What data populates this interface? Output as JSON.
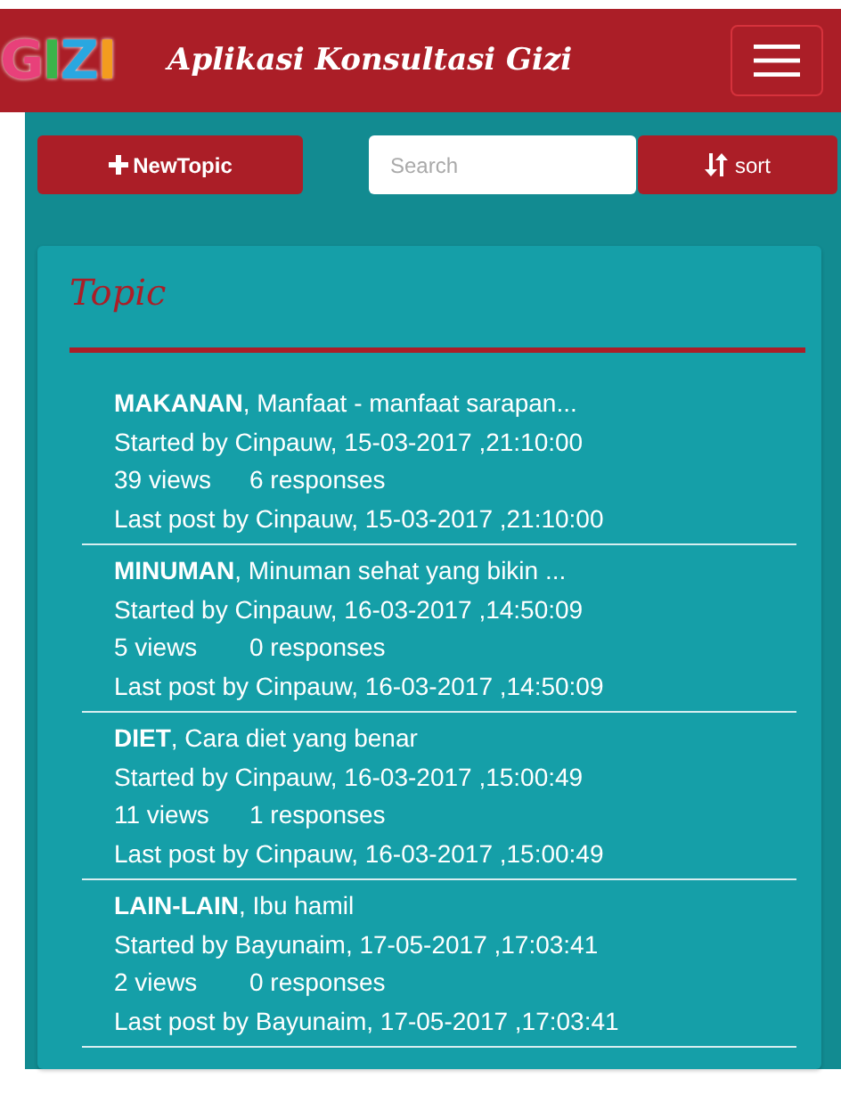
{
  "header": {
    "logo": "GIZI",
    "title": "Aplikasi Konsultasi Gizi"
  },
  "toolbar": {
    "new_topic": "NewTopic",
    "search": {
      "placeholder": "Search"
    },
    "sort": "sort"
  },
  "panel": {
    "title": "Topic",
    "topics": [
      {
        "title": "**MAKANAN**, Manfaat - manfaat sarapan...",
        "started": "Started by Cinpauw, 15-03-2017 ,21:10:00",
        "views": "39 views",
        "responses": "6 responses",
        "last_post": "Last post by Cinpauw, 15-03-2017 ,21:10:00"
      },
      {
        "title": "**MINUMAN**, Minuman sehat yang bikin ...",
        "started": "Started by Cinpauw, 16-03-2017 ,14:50:09",
        "views": "5 views",
        "responses": "0 responses",
        "last_post": "Last post by Cinpauw, 16-03-2017 ,14:50:09"
      },
      {
        "title": "**DIET**, Cara diet yang benar",
        "started": "Started by Cinpauw, 16-03-2017 ,15:00:49",
        "views": "11 views",
        "responses": "1 responses",
        "last_post": "Last post by Cinpauw, 16-03-2017 ,15:00:49"
      },
      {
        "title": "**LAIN-LAIN**, Ibu hamil",
        "started": "Started by Bayunaim, 17-05-2017 ,17:03:41",
        "views": "2 views",
        "responses": "0 responses",
        "last_post": "Last post by Bayunaim, 17-05-2017 ,17:03:41"
      }
    ]
  }
}
